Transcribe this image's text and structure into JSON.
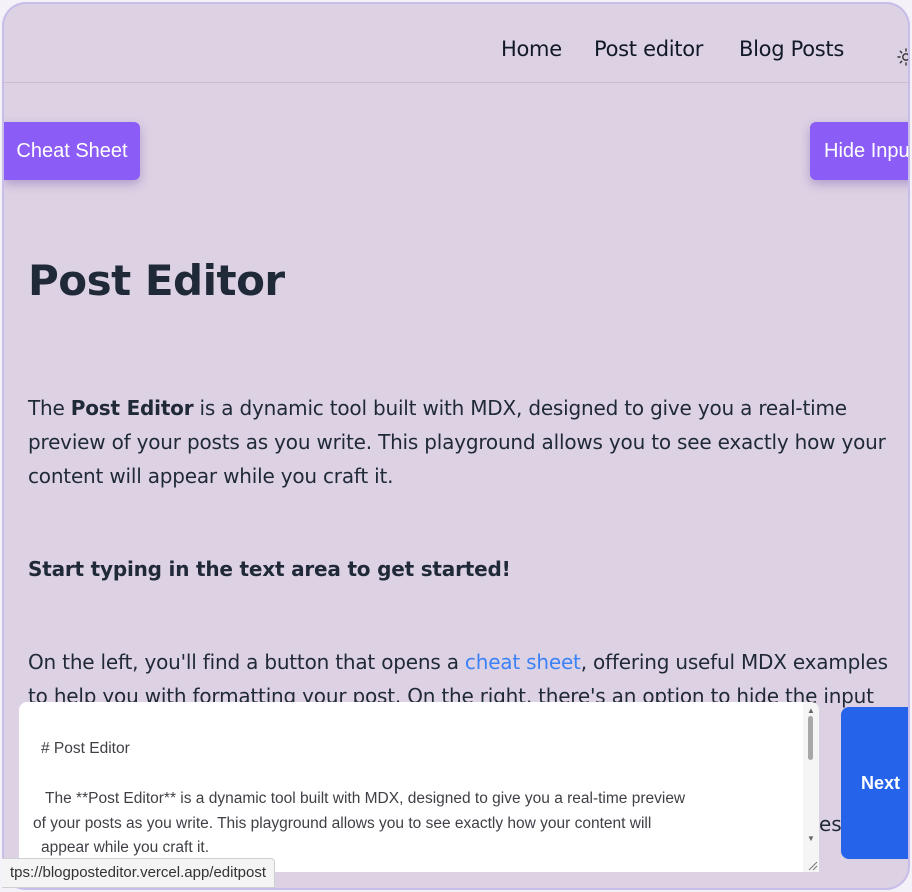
{
  "nav": {
    "home": "Home",
    "post_editor": "Post editor",
    "blog_posts": "Blog Posts",
    "theme_icon": "sun-icon"
  },
  "buttons": {
    "cheat_sheet": "Cheat Sheet",
    "hide_input": "Hide Inpu",
    "next": "Next"
  },
  "content": {
    "title": "Post Editor",
    "p1_prefix": "The ",
    "p1_bold": "Post Editor",
    "p1_rest": " is a dynamic tool built with MDX, designed to give you a real-time preview of your posts as you write. This playground allows you to see exactly how your content will appear while you craft it.",
    "p2": "Start typing in the text area to get started!",
    "p3_prefix": "On the left, you'll find a button that opens a ",
    "p3_link": "cheat sheet",
    "p3_rest": ", offering useful MDX examples to help you with formatting your post. On the right, there's an option to hide the input",
    "bg_overflow": "es"
  },
  "editor": {
    "line1": "# Post Editor",
    "line2": " The **Post Editor** is a dynamic tool built with MDX, designed to give you a real-time preview",
    "line3": "of your posts as you write. This playground allows you to see exactly how your content will",
    "line4": "appear while you craft it."
  },
  "status": {
    "url": "tps://blogposteditor.vercel.app/editpost"
  },
  "colors": {
    "background": "#ddd1e4",
    "accent_purple": "#8b5cf6",
    "accent_blue": "#2563eb",
    "link": "#3b82f6"
  }
}
